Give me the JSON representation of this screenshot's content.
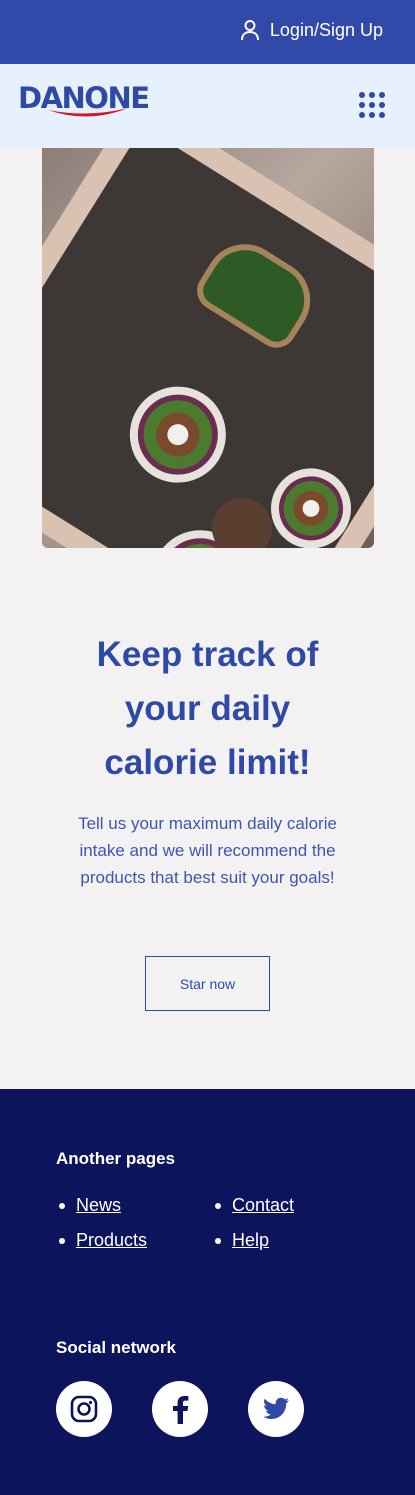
{
  "header": {
    "login_label": "Login/Sign Up",
    "logo_text": "DANONE"
  },
  "hero": {
    "heading_lines": [
      "Keep track of",
      "your daily",
      "calorie limit!"
    ],
    "description": "Tell us your maximum daily calorie intake and we will recommend the products that best suit your goals!",
    "cta_label": "Star now"
  },
  "footer": {
    "pages_title": "Another pages",
    "links": {
      "news": "News",
      "products": "Products",
      "contact": "Contact",
      "help": "Help"
    },
    "social_title": "Social network",
    "social_icons": [
      "instagram-icon",
      "facebook-icon",
      "twitter-icon"
    ]
  },
  "colors": {
    "topbar": "#3149a8",
    "navbar": "#e6f1fd",
    "brand_blue": "#2e4aa6",
    "logo_swoosh": "#d9152b",
    "page_bg": "#f4f1f3",
    "footer_bg": "#0c145c"
  }
}
